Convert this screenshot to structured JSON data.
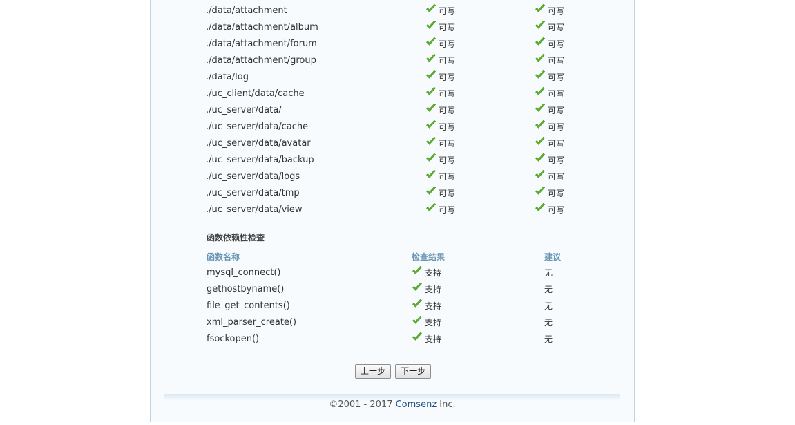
{
  "directories": [
    {
      "path": "./data/attachment",
      "current": "可写",
      "required": "可写"
    },
    {
      "path": "./data/attachment/album",
      "current": "可写",
      "required": "可写"
    },
    {
      "path": "./data/attachment/forum",
      "current": "可写",
      "required": "可写"
    },
    {
      "path": "./data/attachment/group",
      "current": "可写",
      "required": "可写"
    },
    {
      "path": "./data/log",
      "current": "可写",
      "required": "可写"
    },
    {
      "path": "./uc_client/data/cache",
      "current": "可写",
      "required": "可写"
    },
    {
      "path": "./uc_server/data/",
      "current": "可写",
      "required": "可写"
    },
    {
      "path": "./uc_server/data/cache",
      "current": "可写",
      "required": "可写"
    },
    {
      "path": "./uc_server/data/avatar",
      "current": "可写",
      "required": "可写"
    },
    {
      "path": "./uc_server/data/backup",
      "current": "可写",
      "required": "可写"
    },
    {
      "path": "./uc_server/data/logs",
      "current": "可写",
      "required": "可写"
    },
    {
      "path": "./uc_server/data/tmp",
      "current": "可写",
      "required": "可写"
    },
    {
      "path": "./uc_server/data/view",
      "current": "可写",
      "required": "可写"
    }
  ],
  "function_check": {
    "title": "函数依赖性检查",
    "headers": {
      "name": "函数名称",
      "result": "检查结果",
      "advice": "建议"
    },
    "rows": [
      {
        "name": "mysql_connect()",
        "result": "支持",
        "advice": "无"
      },
      {
        "name": "gethostbyname()",
        "result": "支持",
        "advice": "无"
      },
      {
        "name": "file_get_contents()",
        "result": "支持",
        "advice": "无"
      },
      {
        "name": "xml_parser_create()",
        "result": "支持",
        "advice": "无"
      },
      {
        "name": "fsockopen()",
        "result": "支持",
        "advice": "无"
      }
    ]
  },
  "buttons": {
    "prev": "上一步",
    "next": "下一步"
  },
  "footer": {
    "prefix": "©2001 - 2017 ",
    "company": "Comsenz",
    "suffix": " Inc."
  },
  "icons": {
    "status_ok": "check-icon"
  },
  "colors": {
    "check": "#5cb82a",
    "header": "#6b95b4",
    "link": "#1f4e8a",
    "panel": "#f7fbfe"
  }
}
